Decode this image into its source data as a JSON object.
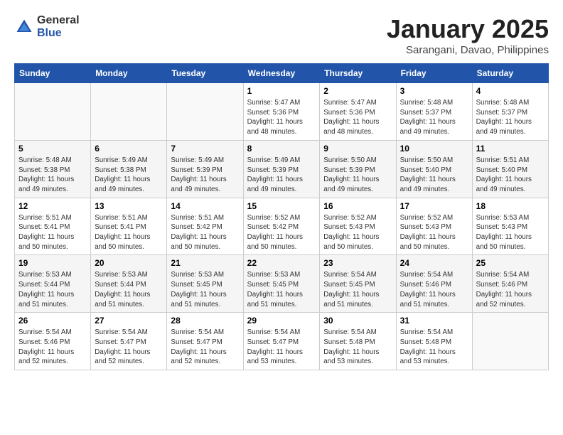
{
  "logo": {
    "general": "General",
    "blue": "Blue"
  },
  "header": {
    "month": "January 2025",
    "location": "Sarangani, Davao, Philippines"
  },
  "weekdays": [
    "Sunday",
    "Monday",
    "Tuesday",
    "Wednesday",
    "Thursday",
    "Friday",
    "Saturday"
  ],
  "weeks": [
    [
      {
        "day": "",
        "info": ""
      },
      {
        "day": "",
        "info": ""
      },
      {
        "day": "",
        "info": ""
      },
      {
        "day": "1",
        "info": "Sunrise: 5:47 AM\nSunset: 5:36 PM\nDaylight: 11 hours and 48 minutes."
      },
      {
        "day": "2",
        "info": "Sunrise: 5:47 AM\nSunset: 5:36 PM\nDaylight: 11 hours and 48 minutes."
      },
      {
        "day": "3",
        "info": "Sunrise: 5:48 AM\nSunset: 5:37 PM\nDaylight: 11 hours and 49 minutes."
      },
      {
        "day": "4",
        "info": "Sunrise: 5:48 AM\nSunset: 5:37 PM\nDaylight: 11 hours and 49 minutes."
      }
    ],
    [
      {
        "day": "5",
        "info": "Sunrise: 5:48 AM\nSunset: 5:38 PM\nDaylight: 11 hours and 49 minutes."
      },
      {
        "day": "6",
        "info": "Sunrise: 5:49 AM\nSunset: 5:38 PM\nDaylight: 11 hours and 49 minutes."
      },
      {
        "day": "7",
        "info": "Sunrise: 5:49 AM\nSunset: 5:39 PM\nDaylight: 11 hours and 49 minutes."
      },
      {
        "day": "8",
        "info": "Sunrise: 5:49 AM\nSunset: 5:39 PM\nDaylight: 11 hours and 49 minutes."
      },
      {
        "day": "9",
        "info": "Sunrise: 5:50 AM\nSunset: 5:39 PM\nDaylight: 11 hours and 49 minutes."
      },
      {
        "day": "10",
        "info": "Sunrise: 5:50 AM\nSunset: 5:40 PM\nDaylight: 11 hours and 49 minutes."
      },
      {
        "day": "11",
        "info": "Sunrise: 5:51 AM\nSunset: 5:40 PM\nDaylight: 11 hours and 49 minutes."
      }
    ],
    [
      {
        "day": "12",
        "info": "Sunrise: 5:51 AM\nSunset: 5:41 PM\nDaylight: 11 hours and 50 minutes."
      },
      {
        "day": "13",
        "info": "Sunrise: 5:51 AM\nSunset: 5:41 PM\nDaylight: 11 hours and 50 minutes."
      },
      {
        "day": "14",
        "info": "Sunrise: 5:51 AM\nSunset: 5:42 PM\nDaylight: 11 hours and 50 minutes."
      },
      {
        "day": "15",
        "info": "Sunrise: 5:52 AM\nSunset: 5:42 PM\nDaylight: 11 hours and 50 minutes."
      },
      {
        "day": "16",
        "info": "Sunrise: 5:52 AM\nSunset: 5:43 PM\nDaylight: 11 hours and 50 minutes."
      },
      {
        "day": "17",
        "info": "Sunrise: 5:52 AM\nSunset: 5:43 PM\nDaylight: 11 hours and 50 minutes."
      },
      {
        "day": "18",
        "info": "Sunrise: 5:53 AM\nSunset: 5:43 PM\nDaylight: 11 hours and 50 minutes."
      }
    ],
    [
      {
        "day": "19",
        "info": "Sunrise: 5:53 AM\nSunset: 5:44 PM\nDaylight: 11 hours and 51 minutes."
      },
      {
        "day": "20",
        "info": "Sunrise: 5:53 AM\nSunset: 5:44 PM\nDaylight: 11 hours and 51 minutes."
      },
      {
        "day": "21",
        "info": "Sunrise: 5:53 AM\nSunset: 5:45 PM\nDaylight: 11 hours and 51 minutes."
      },
      {
        "day": "22",
        "info": "Sunrise: 5:53 AM\nSunset: 5:45 PM\nDaylight: 11 hours and 51 minutes."
      },
      {
        "day": "23",
        "info": "Sunrise: 5:54 AM\nSunset: 5:45 PM\nDaylight: 11 hours and 51 minutes."
      },
      {
        "day": "24",
        "info": "Sunrise: 5:54 AM\nSunset: 5:46 PM\nDaylight: 11 hours and 51 minutes."
      },
      {
        "day": "25",
        "info": "Sunrise: 5:54 AM\nSunset: 5:46 PM\nDaylight: 11 hours and 52 minutes."
      }
    ],
    [
      {
        "day": "26",
        "info": "Sunrise: 5:54 AM\nSunset: 5:46 PM\nDaylight: 11 hours and 52 minutes."
      },
      {
        "day": "27",
        "info": "Sunrise: 5:54 AM\nSunset: 5:47 PM\nDaylight: 11 hours and 52 minutes."
      },
      {
        "day": "28",
        "info": "Sunrise: 5:54 AM\nSunset: 5:47 PM\nDaylight: 11 hours and 52 minutes."
      },
      {
        "day": "29",
        "info": "Sunrise: 5:54 AM\nSunset: 5:47 PM\nDaylight: 11 hours and 53 minutes."
      },
      {
        "day": "30",
        "info": "Sunrise: 5:54 AM\nSunset: 5:48 PM\nDaylight: 11 hours and 53 minutes."
      },
      {
        "day": "31",
        "info": "Sunrise: 5:54 AM\nSunset: 5:48 PM\nDaylight: 11 hours and 53 minutes."
      },
      {
        "day": "",
        "info": ""
      }
    ]
  ]
}
